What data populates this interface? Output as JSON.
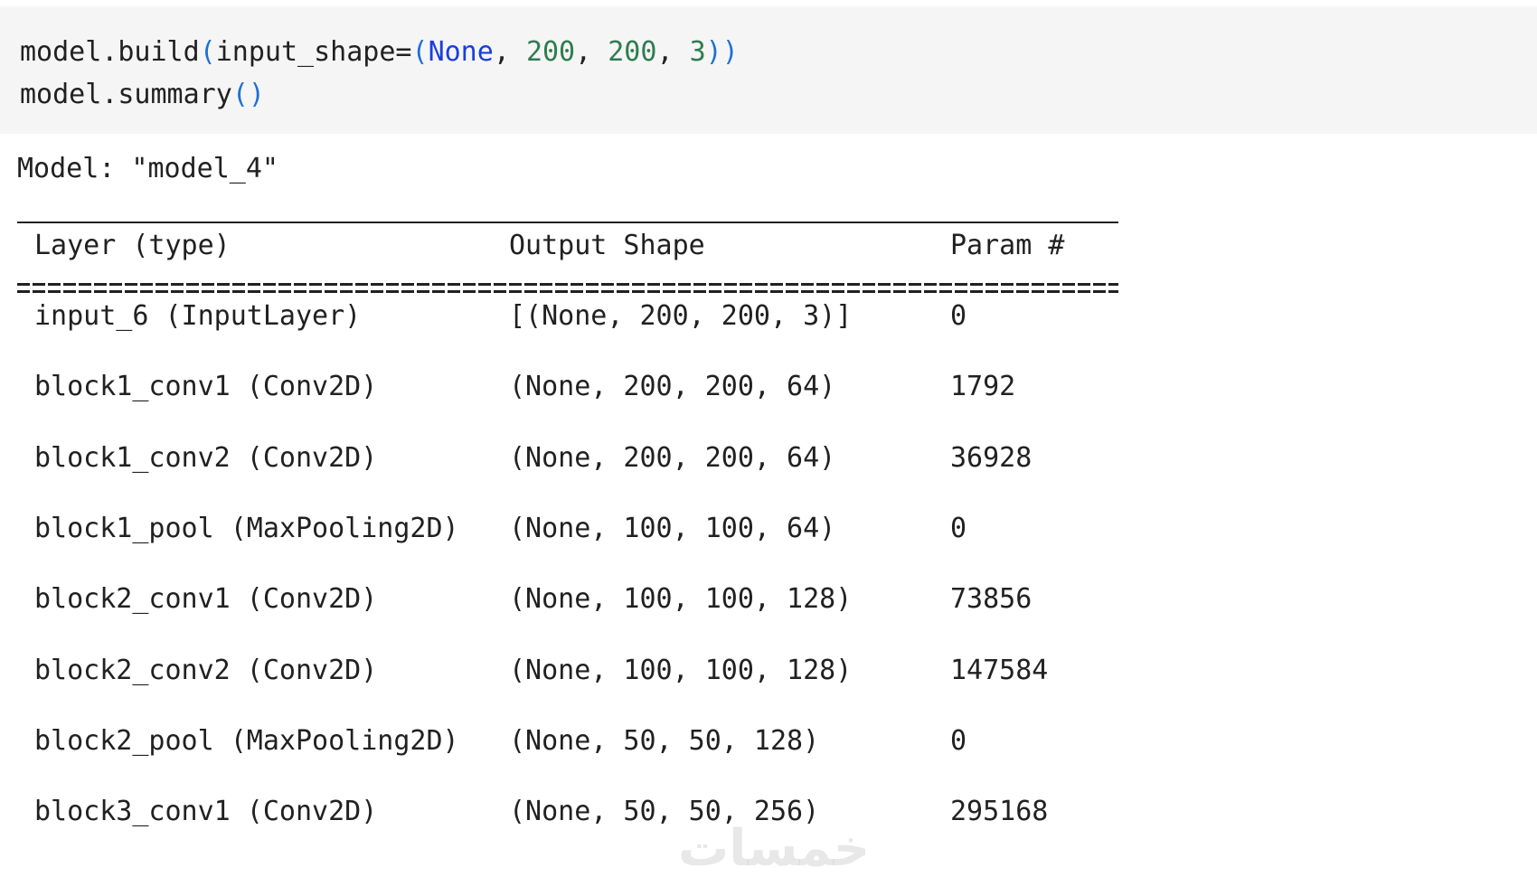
{
  "code": {
    "line1": {
      "prefix": "model.build",
      "open": "(",
      "arg": "input_shape=",
      "tuple_open": "(",
      "none": "None",
      "sep1": ", ",
      "n1": "200",
      "sep2": ", ",
      "n2": "200",
      "sep3": ", ",
      "n3": "3",
      "tuple_close": ")",
      "close": ")"
    },
    "line2": {
      "prefix": "model.summary",
      "open": "(",
      "close": ")"
    }
  },
  "output": {
    "model_title": "Model: \"model_4\"",
    "headers": {
      "layer": "Layer (type)",
      "shape": "Output Shape",
      "param": "Param #"
    },
    "rows": [
      {
        "layer": "input_6 (InputLayer)",
        "shape": "[(None, 200, 200, 3)]",
        "param": "0"
      },
      {
        "layer": "block1_conv1 (Conv2D)",
        "shape": "(None, 200, 200, 64)",
        "param": "1792"
      },
      {
        "layer": "block1_conv2 (Conv2D)",
        "shape": "(None, 200, 200, 64)",
        "param": "36928"
      },
      {
        "layer": "block1_pool (MaxPooling2D)",
        "shape": "(None, 100, 100, 64)",
        "param": "0"
      },
      {
        "layer": "block2_conv1 (Conv2D)",
        "shape": "(None, 100, 100, 128)",
        "param": "73856"
      },
      {
        "layer": "block2_conv2 (Conv2D)",
        "shape": "(None, 100, 100, 128)",
        "param": "147584"
      },
      {
        "layer": "block2_pool (MaxPooling2D)",
        "shape": "(None, 50, 50, 128)",
        "param": "0"
      },
      {
        "layer": "block3_conv1 (Conv2D)",
        "shape": "(None, 50, 50, 256)",
        "param": "295168"
      }
    ],
    "watermark": "خمسات"
  },
  "colors": {
    "code_bg": "#f5f5f5",
    "text": "#212121",
    "paren": "#1f6fd6",
    "keyword_none": "#1a3fd9",
    "number": "#2e7d4f"
  }
}
